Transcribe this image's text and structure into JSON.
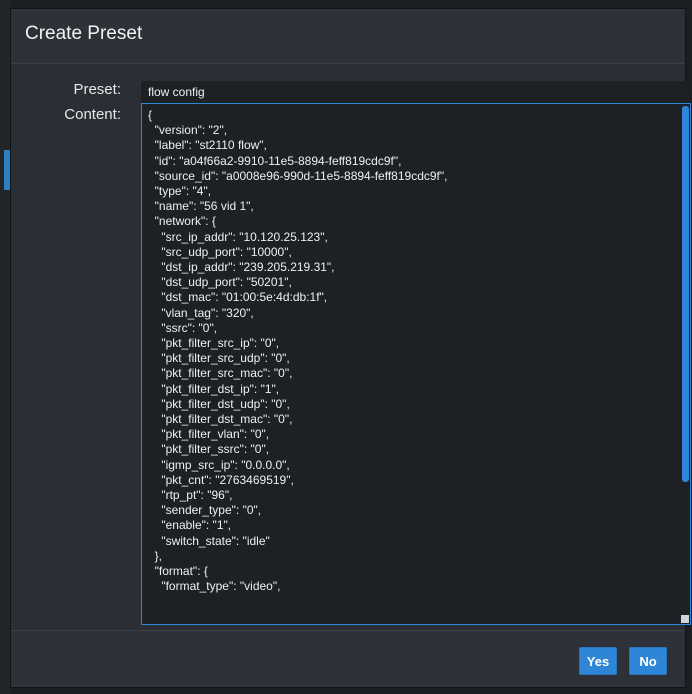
{
  "dialog": {
    "title": "Create Preset",
    "preset_label": "Preset:",
    "preset_value": "flow config",
    "content_label": "Content:",
    "content_lines": [
      "{",
      "  \"version\": \"2\",",
      "  \"label\": \"st2110 flow\",",
      "  \"id\": \"a04f66a2-9910-11e5-8894-feff819cdc9f\",",
      "  \"source_id\": \"a0008e96-990d-11e5-8894-feff819cdc9f\",",
      "  \"type\": \"4\",",
      "  \"name\": \"56 vid 1\",",
      "  \"network\": {",
      "    \"src_ip_addr\": \"10.120.25.123\",",
      "    \"src_udp_port\": \"10000\",",
      "    \"dst_ip_addr\": \"239.205.219.31\",",
      "    \"dst_udp_port\": \"50201\",",
      "    \"dst_mac\": \"01:00:5e:4d:db:1f\",",
      "    \"vlan_tag\": \"320\",",
      "    \"ssrc\": \"0\",",
      "    \"pkt_filter_src_ip\": \"0\",",
      "    \"pkt_filter_src_udp\": \"0\",",
      "    \"pkt_filter_src_mac\": \"0\",",
      "    \"pkt_filter_dst_ip\": \"1\",",
      "    \"pkt_filter_dst_udp\": \"0\",",
      "    \"pkt_filter_dst_mac\": \"0\",",
      "    \"pkt_filter_vlan\": \"0\",",
      "    \"pkt_filter_ssrc\": \"0\",",
      "    \"igmp_src_ip\": \"0.0.0.0\",",
      "    \"pkt_cnt\": \"2763469519\",",
      "    \"rtp_pt\": \"96\",",
      "    \"sender_type\": \"0\",",
      "    \"enable\": \"1\",",
      "    \"switch_state\": \"idle\"",
      "  },",
      "  \"format\": {",
      "    \"format_type\": \"video\","
    ],
    "yes_label": "Yes",
    "no_label": "No"
  },
  "colors": {
    "accent": "#2f86d6",
    "dialog_bg": "#2b2f35",
    "field_bg": "#1d2024"
  }
}
